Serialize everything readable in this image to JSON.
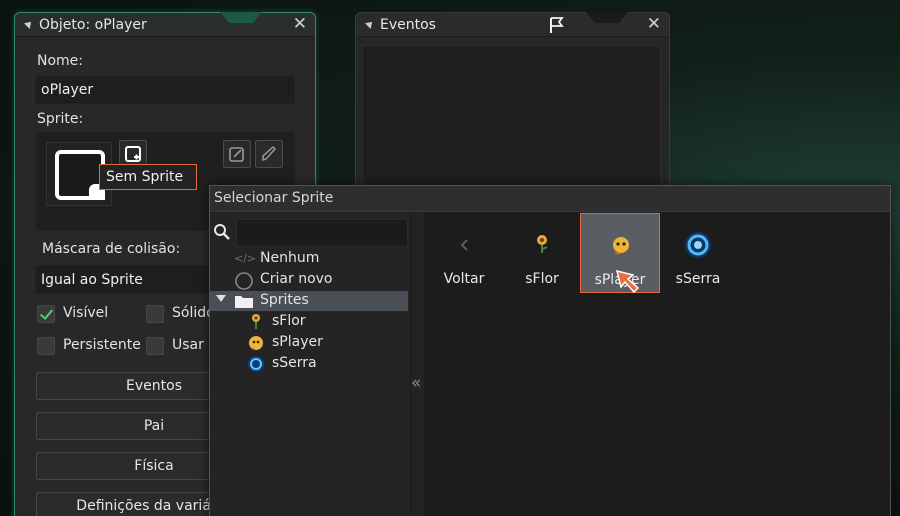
{
  "object_window": {
    "title": "Objeto: oPlayer",
    "close": "✕",
    "name_label": "Nome:",
    "name_value": "oPlayer",
    "sprite_label": "Sprite:",
    "sprite_value": "Sem Sprite",
    "collision_label": "Máscara de colisão:",
    "collision_value": "Igual ao Sprite",
    "checkboxes": [
      {
        "label": "Visível",
        "checked": true
      },
      {
        "label": "Sólido",
        "checked": false
      },
      {
        "label": "Persistente",
        "checked": false
      },
      {
        "label": "Usar Física",
        "checked": false
      }
    ],
    "buttons": [
      "Eventos",
      "Pai",
      "Física",
      "Definições da variável"
    ]
  },
  "events_window": {
    "title": "Eventos",
    "close": "✕"
  },
  "sprite_picker": {
    "title": "Selecionar Sprite",
    "collapse_glyph": "«",
    "tree": [
      {
        "label": "Nenhum",
        "icon": "none-icon"
      },
      {
        "label": "Criar novo",
        "icon": "new-circle-icon"
      },
      {
        "label": "Sprites",
        "icon": "folder-icon",
        "selected": true,
        "expanded": true
      },
      {
        "label": "sFlor",
        "icon": "sflor-sprite-icon"
      },
      {
        "label": "sPlayer",
        "icon": "splayer-sprite-icon"
      },
      {
        "label": "sSerra",
        "icon": "sserra-sprite-icon"
      }
    ],
    "tiles": [
      {
        "label": "Voltar",
        "icon": "back-chevron-icon"
      },
      {
        "label": "sFlor",
        "icon": "sflor-sprite-icon"
      },
      {
        "label": "sPlayer",
        "icon": "splayer-sprite-icon",
        "selected": true
      },
      {
        "label": "sSerra",
        "icon": "sserra-sprite-icon"
      }
    ]
  },
  "colors": {
    "accent": "#e46a3c",
    "window_glow": "#2f8a68",
    "check_green": "#4ccf78"
  }
}
